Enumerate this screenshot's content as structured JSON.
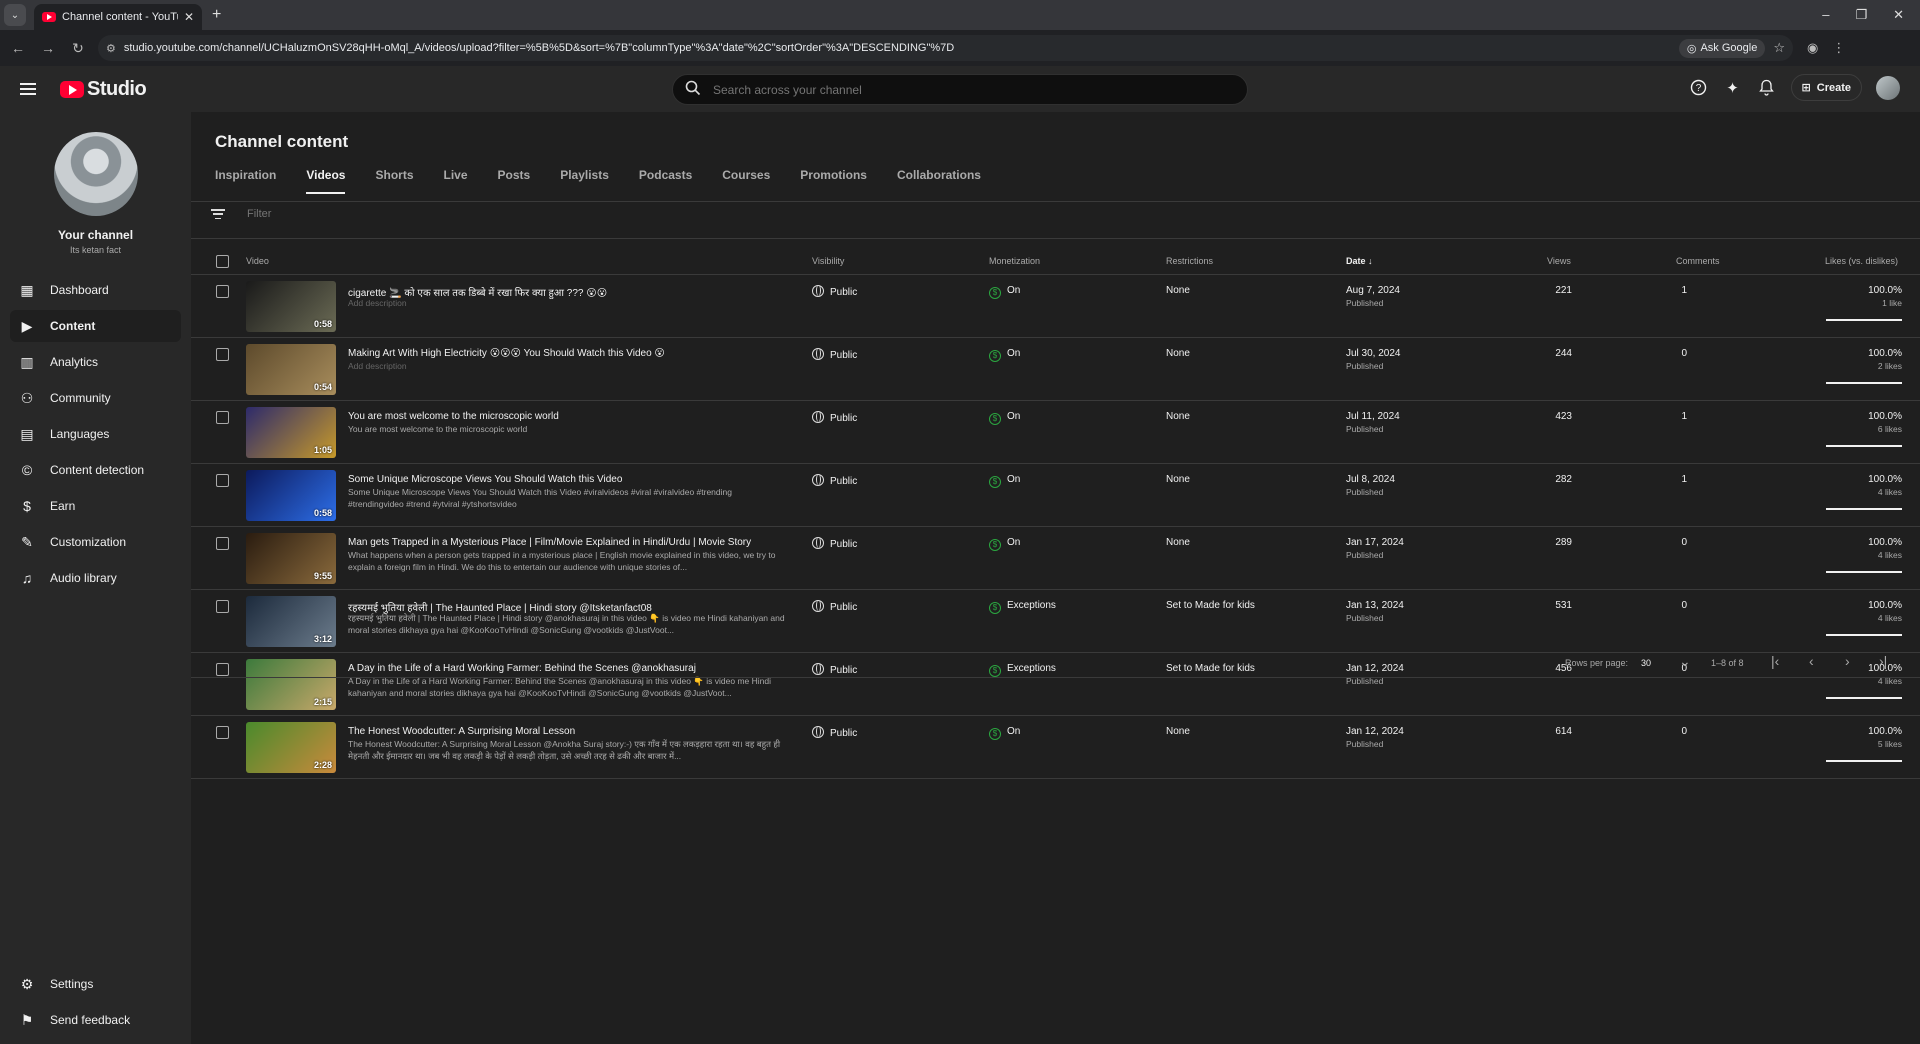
{
  "browser": {
    "tab_title": "Channel content - YouTube Stu",
    "url": "studio.youtube.com/channel/UCHaluzmOnSV28qHH-oMql_A/videos/upload?filter=%5B%5D&sort=%7B\"columnType\"%3A\"date\"%2C\"sortOrder\"%3A\"DESCENDING\"%7D",
    "ask_google": "Ask Google"
  },
  "header": {
    "logo_text": "Studio",
    "search_placeholder": "Search across your channel",
    "create_label": "Create"
  },
  "sidebar": {
    "channel_name": "Your channel",
    "channel_handle": "Its ketan fact",
    "items": [
      {
        "label": "Dashboard",
        "icon": "dashboard-icon"
      },
      {
        "label": "Content",
        "icon": "content-icon",
        "active": true
      },
      {
        "label": "Analytics",
        "icon": "analytics-icon"
      },
      {
        "label": "Community",
        "icon": "community-icon"
      },
      {
        "label": "Languages",
        "icon": "languages-icon"
      },
      {
        "label": "Content detection",
        "icon": "copyright-icon"
      },
      {
        "label": "Earn",
        "icon": "earn-icon"
      },
      {
        "label": "Customization",
        "icon": "customization-icon"
      },
      {
        "label": "Audio library",
        "icon": "audio-library-icon"
      }
    ],
    "settings": "Settings",
    "feedback": "Send feedback"
  },
  "main": {
    "title": "Channel content",
    "tabs": [
      "Inspiration",
      "Videos",
      "Shorts",
      "Live",
      "Posts",
      "Playlists",
      "Podcasts",
      "Courses",
      "Promotions",
      "Collaborations"
    ],
    "active_tab": "Videos",
    "filter_placeholder": "Filter",
    "columns": {
      "video": "Video",
      "visibility": "Visibility",
      "monetization": "Monetization",
      "restrictions": "Restrictions",
      "date": "Date",
      "views": "Views",
      "comments": "Comments",
      "likes": "Likes (vs. dislikes)"
    },
    "rows": [
      {
        "title": "cigarette 🚬 को एक साल तक डिब्बे में रखा फिर क्या हुआ ??? 😮😮",
        "desc": "Add description",
        "placeholder": true,
        "dur": "0:58",
        "vis": "Public",
        "mon": "On",
        "res": "None",
        "date": "Aug 7, 2024",
        "status": "Published",
        "views": "221",
        "comments": "1",
        "likes": "100.0%",
        "likes_sub": "1 like",
        "thumb": [
          "#1a1a1a",
          "#6b6b55"
        ]
      },
      {
        "title": "Making Art With High Electricity 😮😮😮 You Should Watch this Video 😮",
        "desc": "Add description",
        "placeholder": true,
        "dur": "0:54",
        "vis": "Public",
        "mon": "On",
        "res": "None",
        "date": "Jul 30, 2024",
        "status": "Published",
        "views": "244",
        "comments": "0",
        "likes": "100.0%",
        "likes_sub": "2 likes",
        "thumb": [
          "#5d4a2c",
          "#a88d5c"
        ]
      },
      {
        "title": "You are most welcome to the microscopic world",
        "desc": "You are most welcome to the microscopic world",
        "placeholder": false,
        "dur": "1:05",
        "vis": "Public",
        "mon": "On",
        "res": "None",
        "date": "Jul 11, 2024",
        "status": "Published",
        "views": "423",
        "comments": "1",
        "likes": "100.0%",
        "likes_sub": "6 likes",
        "thumb": [
          "#2d2a6b",
          "#c79a2a"
        ]
      },
      {
        "title": "Some Unique Microscope Views You Should Watch this Video",
        "desc": "Some Unique Microscope Views You Should Watch this Video #viralvideos #viral #viralvideo #trending #trendingvideo #trend #ytviral #ytshortsvideo",
        "placeholder": false,
        "dur": "0:58",
        "vis": "Public",
        "mon": "On",
        "res": "None",
        "date": "Jul 8, 2024",
        "status": "Published",
        "views": "282",
        "comments": "1",
        "likes": "100.0%",
        "likes_sub": "4 likes",
        "thumb": [
          "#0c1a5c",
          "#2d6ee8"
        ]
      },
      {
        "title": "Man gets Trapped in a Mysterious Place | Film/Movie Explained in Hindi/Urdu | Movie Story",
        "desc": "What happens when a person gets trapped in a mysterious place | English movie explained in this video, we try to explain a foreign film in Hindi. We do this to entertain our audience with unique stories of...",
        "placeholder": false,
        "dur": "9:55",
        "vis": "Public",
        "mon": "On",
        "res": "None",
        "date": "Jan 17, 2024",
        "status": "Published",
        "views": "289",
        "comments": "0",
        "likes": "100.0%",
        "likes_sub": "4 likes",
        "thumb": [
          "#2a1c10",
          "#8a6a3c"
        ]
      },
      {
        "title": "रहस्यमई भुतिया हवेली | The Haunted Place | Hindi story @Itsketanfact08",
        "desc": "रहस्यमई भुतिया हवेली | The Haunted Place | Hindi story @anokhasuraj in this video 👇 is video me Hindi kahaniyan and moral stories dikhaya gya hai @KooKooTvHindi @SonicGung @vootkids @JustVoot...",
        "placeholder": false,
        "dur": "3:12",
        "vis": "Public",
        "mon": "Exceptions",
        "res": "Set to Made for kids",
        "date": "Jan 13, 2024",
        "status": "Published",
        "views": "531",
        "comments": "0",
        "likes": "100.0%",
        "likes_sub": "4 likes",
        "thumb": [
          "#1c2a3c",
          "#6c7c8c"
        ]
      },
      {
        "title": "A Day in the Life of a Hard Working Farmer: Behind the Scenes @anokhasuraj",
        "desc": "A Day in the Life of a Hard Working Farmer: Behind the Scenes @anokhasuraj in this video 👇 is video me Hindi kahaniyan and moral stories dikhaya gya hai @KooKooTvHindi @SonicGung @vootkids @JustVoot...",
        "placeholder": false,
        "dur": "2:15",
        "vis": "Public",
        "mon": "Exceptions",
        "res": "Set to Made for kids",
        "date": "Jan 12, 2024",
        "status": "Published",
        "views": "456",
        "comments": "0",
        "likes": "100.0%",
        "likes_sub": "4 likes",
        "thumb": [
          "#3c7a3c",
          "#c9a86a"
        ]
      },
      {
        "title": "The Honest Woodcutter: A Surprising Moral Lesson",
        "desc": "The Honest Woodcutter: A Surprising Moral Lesson @Anokha Suraj story:-) एक गाँव में एक लकड़हारा रहता था। वह बहुत ही मेहनती और ईमानदार था। जब भी वह लकड़ी के पेड़ों से लकड़ी तोड़ता, उसे अच्छी तरह से ढकी और बाजार में...",
        "placeholder": false,
        "dur": "2:28",
        "vis": "Public",
        "mon": "On",
        "res": "None",
        "date": "Jan 12, 2024",
        "status": "Published",
        "views": "614",
        "comments": "0",
        "likes": "100.0%",
        "likes_sub": "5 likes",
        "thumb": [
          "#4a8a2c",
          "#c98a3c"
        ]
      }
    ],
    "pagination": {
      "rows_label": "Rows per page:",
      "rows_value": "30",
      "range": "1–8 of 8"
    }
  }
}
